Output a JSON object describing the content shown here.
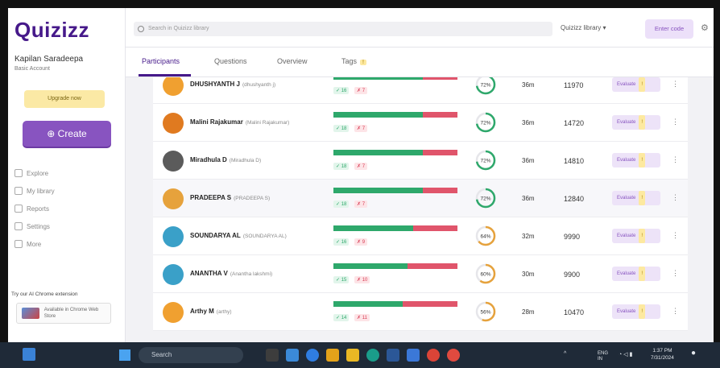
{
  "app": {
    "logo": "Quizizz"
  },
  "sidebar": {
    "user_name": "Kapilan Saradeepa",
    "plan": "Basic Account",
    "upgrade_label": "Upgrade now",
    "create_label": "⊕ Create",
    "nav": [
      {
        "label": "Explore",
        "icon": "compass-icon"
      },
      {
        "label": "My library",
        "icon": "library-icon"
      },
      {
        "label": "Reports",
        "icon": "reports-icon"
      },
      {
        "label": "Settings",
        "icon": "gear-icon"
      },
      {
        "label": "More",
        "icon": "more-icon"
      }
    ],
    "extension_title": "Try our AI Chrome extension",
    "extension_text": "Available in Chrome Web Store"
  },
  "topbar": {
    "search_placeholder": "Search in Quizizz library",
    "library_label": "Quizizz library ▾",
    "enter_code_label": "Enter code"
  },
  "tabs": [
    {
      "label": "Participants",
      "active": true
    },
    {
      "label": "Questions",
      "active": false
    },
    {
      "label": "Overview",
      "active": false
    },
    {
      "label": "Tags",
      "active": false,
      "badge": "!"
    }
  ],
  "participants": [
    {
      "name": "DHUSHYANTH J",
      "sub": "(dhushyanth j)",
      "correct_fraction": 0.72,
      "correct": "✓ 16",
      "wrong": "✗ 7",
      "accuracy": "72%",
      "accuracy_value": 72,
      "time": "36m",
      "score": "11970",
      "evaluate": "Evaluate",
      "avatar_color": "#f0a030",
      "highlight": false
    },
    {
      "name": "Malini Rajakumar",
      "sub": "(Malini Rajakumar)",
      "correct_fraction": 0.72,
      "correct": "✓ 18",
      "wrong": "✗ 7",
      "accuracy": "72%",
      "accuracy_value": 72,
      "time": "36m",
      "score": "14720",
      "evaluate": "Evaluate",
      "avatar_color": "#e07a20",
      "highlight": false
    },
    {
      "name": "Miradhula D",
      "sub": "(Miradhula D)",
      "correct_fraction": 0.72,
      "correct": "✓ 18",
      "wrong": "✗ 7",
      "accuracy": "72%",
      "accuracy_value": 72,
      "time": "36m",
      "score": "14810",
      "evaluate": "Evaluate",
      "avatar_color": "#5b5b5b",
      "highlight": false
    },
    {
      "name": "PRADEEPA S",
      "sub": "(PRADEEPA S)",
      "correct_fraction": 0.72,
      "correct": "✓ 18",
      "wrong": "✗ 7",
      "accuracy": "72%",
      "accuracy_value": 72,
      "time": "36m",
      "score": "12840",
      "evaluate": "Evaluate",
      "avatar_color": "#e6a23c",
      "highlight": true
    },
    {
      "name": "SOUNDARYA AL",
      "sub": "(SOUNDARYA AL)",
      "correct_fraction": 0.64,
      "correct": "✓ 16",
      "wrong": "✗ 9",
      "accuracy": "64%",
      "accuracy_value": 64,
      "time": "32m",
      "score": "9990",
      "evaluate": "Evaluate",
      "avatar_color": "#3aa0c8",
      "highlight": false
    },
    {
      "name": "ANANTHA V",
      "sub": "(Anantha lakshmi)",
      "correct_fraction": 0.6,
      "correct": "✓ 15",
      "wrong": "✗ 10",
      "accuracy": "60%",
      "accuracy_value": 60,
      "time": "30m",
      "score": "9900",
      "evaluate": "Evaluate",
      "avatar_color": "#3aa0c8",
      "highlight": false
    },
    {
      "name": "Arthy M",
      "sub": "(arthy)",
      "correct_fraction": 0.56,
      "correct": "✓ 14",
      "wrong": "✗ 11",
      "accuracy": "56%",
      "accuracy_value": 56,
      "time": "28m",
      "score": "10470",
      "evaluate": "Evaluate",
      "avatar_color": "#f0a030",
      "highlight": false
    }
  ],
  "colors": {
    "brand": "#46198a",
    "accent": "#8854c0",
    "correct": "#2ea86b",
    "wrong": "#e0556b"
  },
  "taskbar": {
    "search_placeholder": "Search",
    "lang": "ENG IN",
    "time": "1:37 PM",
    "date": "7/31/2024"
  }
}
